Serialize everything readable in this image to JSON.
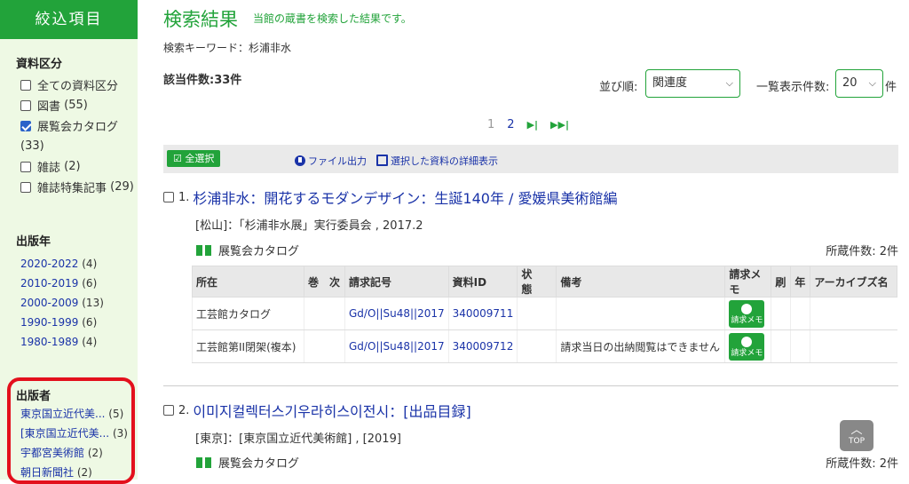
{
  "sidebar": {
    "header": "絞込項目",
    "material_type": {
      "title": "資料区分",
      "items": [
        {
          "label": "全ての資料区分",
          "count": "",
          "checked": false
        },
        {
          "label": "図書",
          "count": "(55)",
          "checked": false
        },
        {
          "label": "展覧会カタログ",
          "count": "(33)",
          "checked": true
        },
        {
          "label": "雑誌",
          "count": "(2)",
          "checked": false
        },
        {
          "label": "雑誌特集記事",
          "count": "(29)",
          "checked": false
        }
      ]
    },
    "year": {
      "title": "出版年",
      "items": [
        {
          "label": "2020-2022",
          "count": "(4)"
        },
        {
          "label": "2010-2019",
          "count": "(6)"
        },
        {
          "label": "2000-2009",
          "count": "(13)"
        },
        {
          "label": "1990-1999",
          "count": "(6)"
        },
        {
          "label": "1980-1989",
          "count": "(4)"
        }
      ]
    },
    "publisher": {
      "title": "出版者",
      "items": [
        {
          "label": "東京国立近代美...",
          "count": "(5)"
        },
        {
          "label": "[東京国立近代美...",
          "count": "(3)"
        },
        {
          "label": "宇都宮美術館",
          "count": "(2)"
        },
        {
          "label": "朝日新聞社",
          "count": "(2)"
        }
      ]
    }
  },
  "main": {
    "title": "検索結果",
    "subtitle": "当館の蔵書を検索した結果です。",
    "keyword": "検索キーワード：杉浦非水",
    "hits": "該当件数:33件",
    "sort_label": "並び順:",
    "sort_value": "関連度",
    "count_label": "一覧表示件数:",
    "count_value": "20",
    "count_suffix": "件",
    "pager": {
      "current": "1",
      "next_page": "2",
      "next": "▶|",
      "last": "▶▶|"
    },
    "toolbar": {
      "select_all": "全選択",
      "file_export": "ファイル出力",
      "selected_detail": "選択した資料の詳細表示"
    }
  },
  "records": [
    {
      "no": "1.",
      "title": "杉浦非水：開花するモダンデザイン：生誕140年 / 愛媛県美術館編",
      "publication": "[松山]：「杉浦非水展」実行委員会 , 2017.2",
      "type": "展覧会カタログ",
      "holdings": "所蔵件数: 2件",
      "table": {
        "headers": [
          "所在",
          "巻　次",
          "請求記号",
          "資料ID",
          "状　態",
          "備考",
          "請求メモ",
          "刷",
          "年",
          "アーカイブズ名"
        ],
        "rows": [
          {
            "location": "工芸館カタログ",
            "volume": "",
            "call_no": "Gd/O||Su48||2017",
            "id": "340009711",
            "status": "",
            "note": "",
            "memo": "請求メモ"
          },
          {
            "location": "工芸館第II閉架(複本)",
            "volume": "",
            "call_no": "Gd/O||Su48||2017",
            "id": "340009712",
            "status": "",
            "note": "請求当日の出納閲覧はできません",
            "memo": "請求メモ"
          }
        ]
      }
    },
    {
      "no": "2.",
      "title": "이미지컬렉터스기우라히스이전시：[出品目録]",
      "publication": "[東京]：[東京国立近代美術館] , [2019]",
      "type": "展覧会カタログ",
      "holdings": "所蔵件数: 2件"
    }
  ],
  "top_button": "TOP"
}
